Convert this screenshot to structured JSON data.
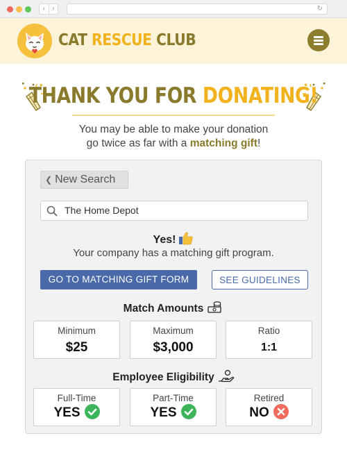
{
  "brand": {
    "word1": "CAT ",
    "word2": "RESCUE",
    "word3": " CLUB"
  },
  "icons": {
    "logo": "cat-logo-icon",
    "menu": "hamburger-menu-icon",
    "confetti": "party-popper-icon",
    "search": "search-icon",
    "thumbs": "thumbs-up-icon",
    "money": "money-stack-icon",
    "eligibility": "hand-coin-icon",
    "check": "check-circle-icon",
    "cross": "x-circle-icon"
  },
  "colors": {
    "brand_olive": "#8a7a2c",
    "brand_gold": "#f2b21d",
    "header_bg": "#fdf3d8",
    "primary_blue": "#4a69a8",
    "yes_green": "#3cb55a",
    "no_red": "#f06b5d"
  },
  "heading": {
    "part1": "THANK YOU FOR ",
    "part2": "DONATING!"
  },
  "subtext": {
    "line1": "You may be able to make your donation",
    "line2_pre": "go twice as far with a ",
    "line2_hl": "matching gift",
    "line2_post": "!"
  },
  "search": {
    "back_label": "New Search",
    "value": "The Home Depot"
  },
  "result": {
    "yes": "Yes!",
    "message": "Your company has a matching gift program."
  },
  "buttons": {
    "form": "GO TO MATCHING GIFT FORM",
    "guidelines": "SEE GUIDELINES"
  },
  "match": {
    "title": "Match Amounts",
    "items": [
      {
        "label": "Minimum",
        "value": "$25"
      },
      {
        "label": "Maximum",
        "value": "$3,000"
      },
      {
        "label": "Ratio",
        "value": "1:1"
      }
    ]
  },
  "eligibility": {
    "title": "Employee Eligibility",
    "items": [
      {
        "label": "Full-Time",
        "value": "YES",
        "eligible": true
      },
      {
        "label": "Part-Time",
        "value": "YES",
        "eligible": true
      },
      {
        "label": "Retired",
        "value": "NO",
        "eligible": false
      }
    ]
  }
}
